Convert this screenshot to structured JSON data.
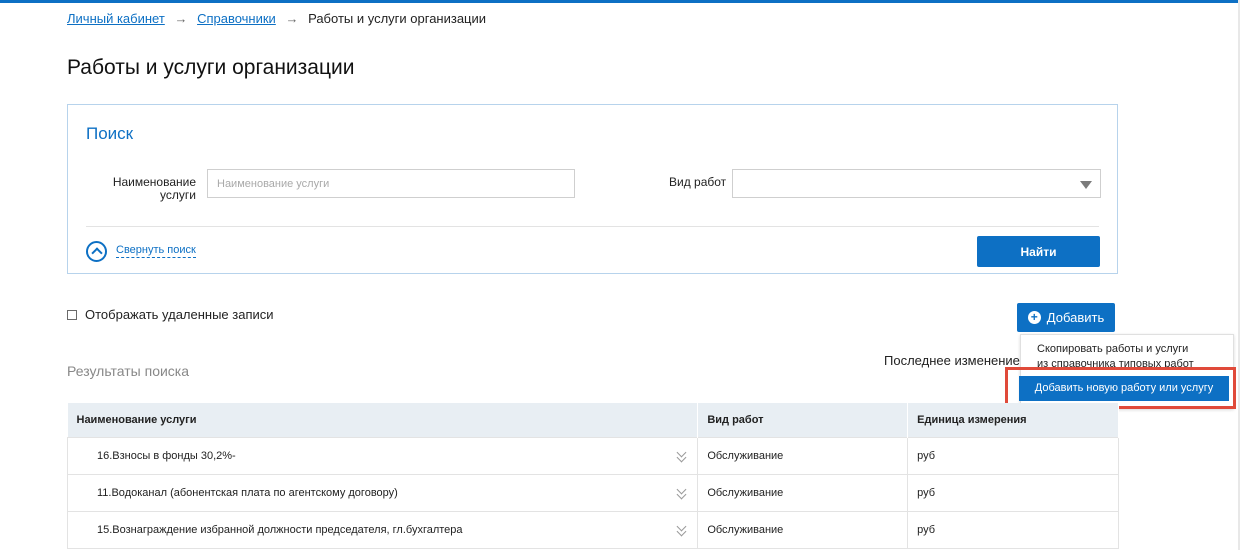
{
  "breadcrumb": {
    "items": [
      "Личный кабинет",
      "Справочники"
    ],
    "separator": "→",
    "current": "Работы и услуги организации"
  },
  "page": {
    "title": "Работы и услуги организации"
  },
  "search": {
    "title": "Поиск",
    "name_label": "Наименование услуги",
    "name_placeholder": "Наименование услуги",
    "name_value": "",
    "kind_label": "Вид работ",
    "kind_value": "",
    "collapse_label": "Свернуть поиск",
    "find_label": "Найти"
  },
  "options": {
    "show_deleted_label": "Отображать удаленные записи",
    "show_deleted_checked": false
  },
  "add_button": {
    "label": "Добавить",
    "icon": "plus-circle-icon"
  },
  "add_menu": {
    "copy_label_line1": "Скопировать работы и услуги",
    "copy_label_line2": "из справочника типовых работ",
    "add_new_label": "Добавить новую работу или услугу"
  },
  "last_change_label": "Последнее изменение:",
  "results": {
    "title": "Результаты поиска",
    "columns": [
      "Наименование услуги",
      "Вид работ",
      "Единица измерения"
    ],
    "rows": [
      {
        "name": "16.Взносы в фонды 30,2%-",
        "kind": "Обслуживание",
        "unit": "руб"
      },
      {
        "name": "11.Водоканал (абонентская плата по агентскому договору)",
        "kind": "Обслуживание",
        "unit": "руб"
      },
      {
        "name": "15.Вознаграждение избранной должности председателя, гл.бухгалтера",
        "kind": "Обслуживание",
        "unit": "руб"
      }
    ]
  },
  "colors": {
    "accent": "#0d70c4",
    "highlight": "#e04a3a",
    "header_bg": "#e8eef3"
  }
}
